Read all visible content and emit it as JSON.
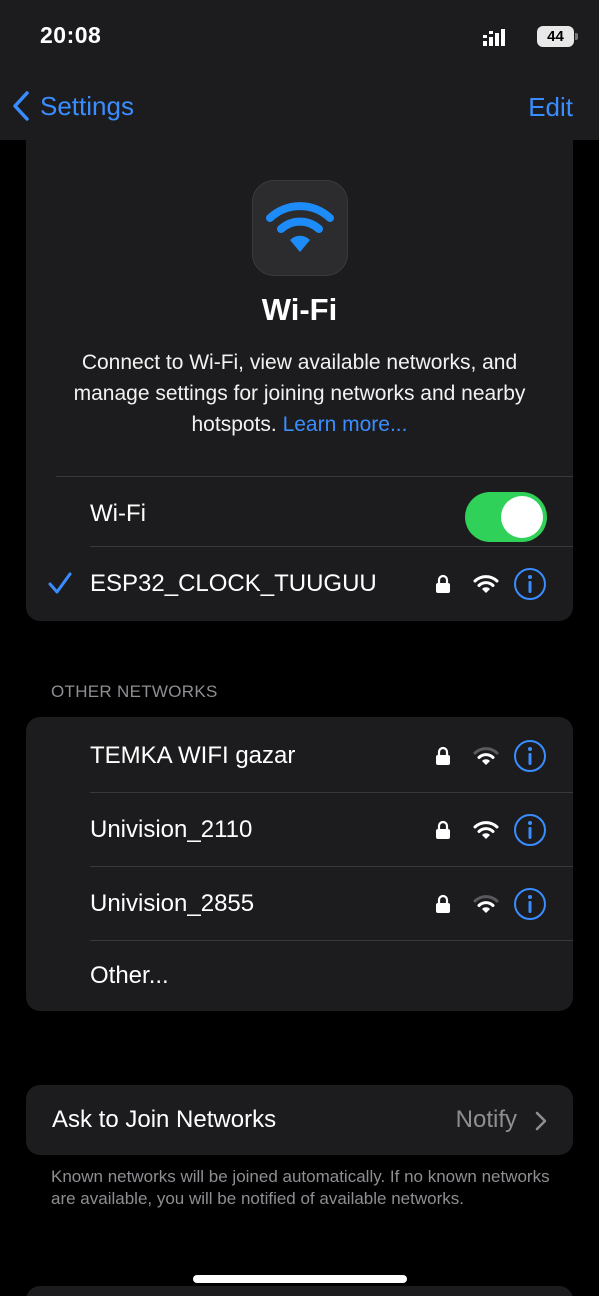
{
  "status_bar": {
    "time": "20:08",
    "battery": "44"
  },
  "nav": {
    "back_label": "Settings",
    "edit_label": "Edit"
  },
  "hero": {
    "title": "Wi-Fi",
    "description": "Connect to Wi-Fi, view available networks, and manage settings for joining networks and nearby hotspots.",
    "learn_more": "Learn more..."
  },
  "wifi_toggle": {
    "label": "Wi-Fi",
    "on": true
  },
  "connected_network": {
    "name": "ESP32_CLOCK_TUUGUU",
    "secured": true,
    "signal": "full"
  },
  "other_networks": {
    "header": "OTHER NETWORKS",
    "items": [
      {
        "name": "TEMKA WIFI gazar",
        "secured": true,
        "signal": "medium"
      },
      {
        "name": "Univision_2110",
        "secured": true,
        "signal": "full"
      },
      {
        "name": "Univision_2855",
        "secured": true,
        "signal": "medium"
      }
    ],
    "other_label": "Other..."
  },
  "ask_to_join": {
    "label": "Ask to Join Networks",
    "value": "Notify",
    "note": "Known networks will be joined automatically. If no known networks are available, you will be notified of available networks."
  },
  "colors": {
    "accent": "#3a8dff",
    "toggle_on": "#30d158",
    "card_bg": "#1c1c1e",
    "secondary_text": "#8e8e93"
  },
  "icons": [
    "back-chevron-icon",
    "wifi-icon",
    "checkmark-icon",
    "lock-icon",
    "info-icon",
    "chevron-right-icon"
  ]
}
